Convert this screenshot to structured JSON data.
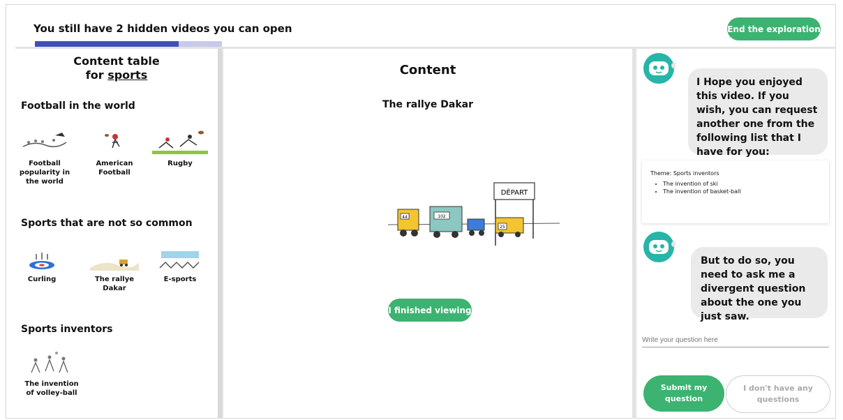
{
  "header": {
    "hidden_videos_text": "You still have 2 hidden videos you can open",
    "progress_fraction": 0.77,
    "end_button": "End the exploration"
  },
  "toc": {
    "title_line1": "Content table",
    "title_line2_prefix": "for ",
    "title_topic": "sports",
    "sections": [
      {
        "title": "Football in the world",
        "items": [
          "Football popularity in the world",
          "American Football",
          "Rugby"
        ]
      },
      {
        "title": "Sports that are not so common",
        "items": [
          "Curling",
          "The rallye Dakar",
          "E-sports"
        ]
      },
      {
        "title": "Sports inventors",
        "items": [
          "The invention of volley-ball"
        ]
      }
    ]
  },
  "content": {
    "heading": "Content",
    "video_title": "The rallye Dakar",
    "sign_text": "DÉPART",
    "car_numbers": [
      "44",
      "102",
      "25"
    ],
    "finished_button": "I finished viewing"
  },
  "chat": {
    "message1": "I Hope you enjoyed this video. If you wish, you can request another one from the following list that I have for you:",
    "theme_label": "Theme: Sports inventors",
    "theme_items": [
      "The invention of ski",
      "The invention of basket-ball"
    ],
    "message2": "But to do so, you need to ask me a divergent question about the one you just saw.",
    "input_placeholder": "Write your question here",
    "submit_button": "Submit my question",
    "no_questions_button": "I don't have any questions"
  },
  "colors": {
    "accent_green": "#3cb371",
    "progress_blue": "#3f51b5",
    "robot_teal": "#26b5a8"
  }
}
